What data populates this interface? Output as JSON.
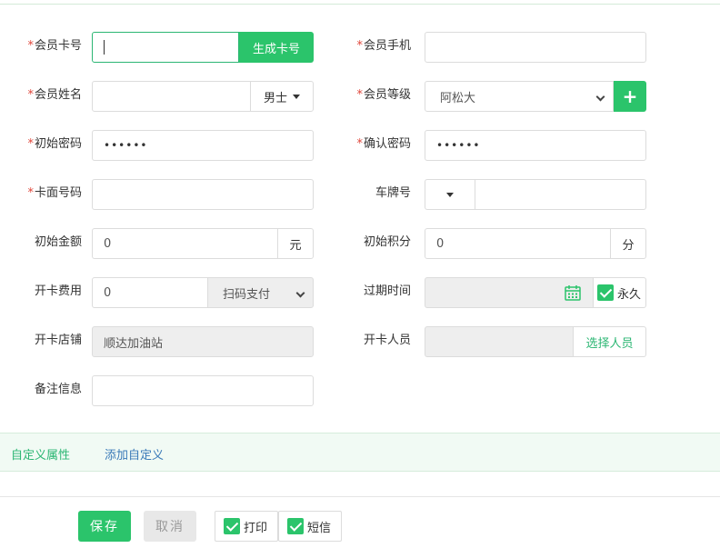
{
  "form": {
    "card_no": {
      "label": "会员卡号",
      "required": "*",
      "value": "",
      "gen_button": "生成卡号"
    },
    "phone": {
      "label": "会员手机",
      "required": "*",
      "value": ""
    },
    "name": {
      "label": "会员姓名",
      "required": "*",
      "value": "",
      "gender": "男士"
    },
    "level": {
      "label": "会员等级",
      "required": "*",
      "selected": "阿松大"
    },
    "init_pwd": {
      "label": "初始密码",
      "required": "*",
      "value": "••••••"
    },
    "confirm_pwd": {
      "label": "确认密码",
      "required": "*",
      "value": "••••••"
    },
    "face_no": {
      "label": "卡面号码",
      "required": "*",
      "value": ""
    },
    "plate": {
      "label": "车牌号",
      "value": ""
    },
    "init_amount": {
      "label": "初始金额",
      "value": "0",
      "unit": "元"
    },
    "init_points": {
      "label": "初始积分",
      "value": "0",
      "unit": "分"
    },
    "fee": {
      "label": "开卡费用",
      "value": "0",
      "pay_method": "扫码支付"
    },
    "expire": {
      "label": "过期时间",
      "value": "",
      "forever": "永久"
    },
    "store": {
      "label": "开卡店铺",
      "value": "顺达加油站"
    },
    "staff": {
      "label": "开卡人员",
      "value": "",
      "select_button": "选择人员"
    },
    "remark": {
      "label": "备注信息",
      "value": ""
    }
  },
  "custom": {
    "title": "自定义属性",
    "add": "添加自定义"
  },
  "footer": {
    "save": "保存",
    "cancel": "取消",
    "print": "打印",
    "sms": "短信"
  },
  "colors": {
    "accent": "#2bc46b",
    "required": "#e0463a",
    "link": "#3a7ab8"
  }
}
